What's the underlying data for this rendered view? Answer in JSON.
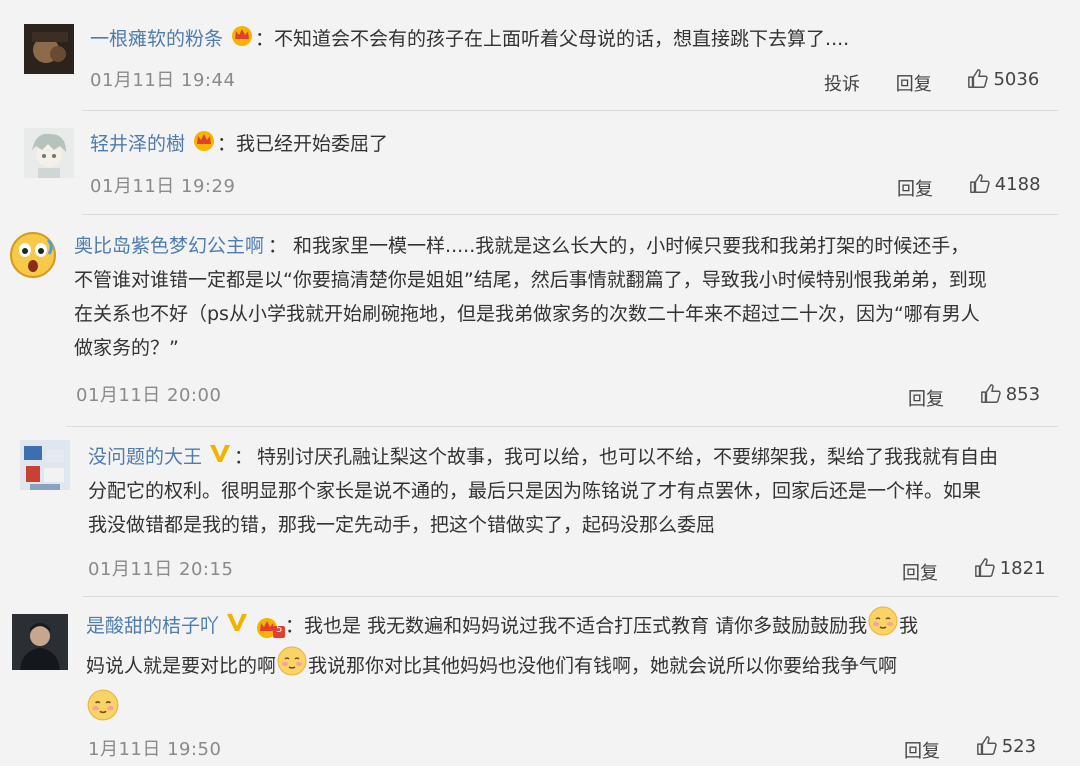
{
  "comments": [
    {
      "user": "一根瘫软的粉条",
      "sep": "：",
      "text": "不知道会不会有的孩子在上面听着父母说的话，想直接跳下去算了....",
      "time": "01月11日 19:44",
      "report": "投诉",
      "reply": "回复",
      "likes": "5036"
    },
    {
      "user": "轻井泽的樹",
      "sep": "：",
      "text": "我已经开始委屈了",
      "time": "01月11日 19:29",
      "reply": "回复",
      "likes": "4188"
    },
    {
      "user": "奥比岛紫色梦幻公主啊",
      "sep": "：",
      "text_first": "和我家里一模一样.....我就是这么长大的，小时候只要我和我弟打架的时候还手，",
      "text_lines": [
        "不管谁对谁错一定都是以“你要搞清楚你是姐姐”结尾，然后事情就翻篇了，导致我小时候特别恨我弟弟，到现",
        "在关系也不好（ps从小学我就开始刷碗拖地，但是我弟做家务的次数二十年来不超过二十次，因为“哪有男人",
        "做家务的？”"
      ],
      "time": "01月11日 20:00",
      "reply": "回复",
      "likes": "853"
    },
    {
      "user": "没问题的大王",
      "verified": "V",
      "sep": "：",
      "text_first": "特别讨厌孔融让梨这个故事，我可以给，也可以不给，不要绑架我，梨给了我我就有自由",
      "text_lines": [
        "分配它的权利。很明显那个家长是说不通的，最后只是因为陈铭说了才有点罢休，回家后还是一个样。如果",
        "我没做错都是我的错，那我一定先动手，把这个错做实了，起码没那么委屈"
      ],
      "time": "01月11日 20:15",
      "reply": "回复",
      "likes": "1821"
    },
    {
      "user": "是酸甜的桔子吖",
      "verified": "V",
      "level": "5",
      "sep": "：",
      "seg1": "我也是 我无数遍和妈妈说过我不适合打压式教育 请你多鼓励鼓励我",
      "seg2": "我",
      "seg3": "妈说人就是要对比的啊",
      "seg4": "我说那你对比其他妈妈也没他们有钱啊，她就会说所以你要给我争气啊",
      "time": "1月11日 19:50",
      "reply": "回复",
      "likes": "523"
    }
  ],
  "colors": {
    "username": "#4f7cae",
    "text": "#333333",
    "time": "#8a8a8a",
    "background": "#f3f3f3",
    "verified": "#f0b400"
  },
  "icons": [
    "crown-badge-icon",
    "verified-v-icon",
    "thumb-up-icon",
    "shy-emoji-icon",
    "surprised-emoji-avatar"
  ]
}
